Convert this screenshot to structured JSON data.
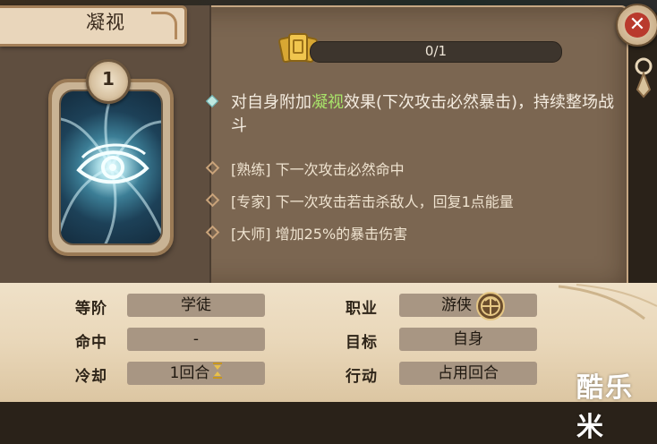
{
  "skill": {
    "title": "凝视",
    "level": "1",
    "progress_text": "0/1",
    "progress_value": 0,
    "description_pre": "对自身附加",
    "description_keyword": "凝视",
    "description_post": "效果(下次攻击必然暴击)，持续整场战斗",
    "perks": [
      {
        "tier": "[熟练]",
        "text": "下一次攻击必然命中"
      },
      {
        "tier": "[专家]",
        "text": "下一次攻击若击杀敌人，回复1点能量"
      },
      {
        "tier": "[大师]",
        "text": "增加25%的暴击伤害"
      }
    ]
  },
  "stats": {
    "rank_label": "等阶",
    "rank_value": "学徒",
    "hit_label": "命中",
    "hit_value": "-",
    "cooldown_label": "冷却",
    "cooldown_value": "1回合",
    "class_label": "职业",
    "class_value": "游侠",
    "target_label": "目标",
    "target_value": "自身",
    "action_label": "行动",
    "action_value": "占用回合"
  },
  "watermark": "酷乐米",
  "icons": {
    "close": "close-icon",
    "cards": "card-stack-icon",
    "class": "ranger-class-icon",
    "cooldown": "hourglass-icon",
    "skill_art": "eye-icon"
  },
  "colors": {
    "keyword": "#a8e36a",
    "close": "#b93a2d",
    "panel": "#7b6651",
    "parchment": "#e9d7b9"
  }
}
